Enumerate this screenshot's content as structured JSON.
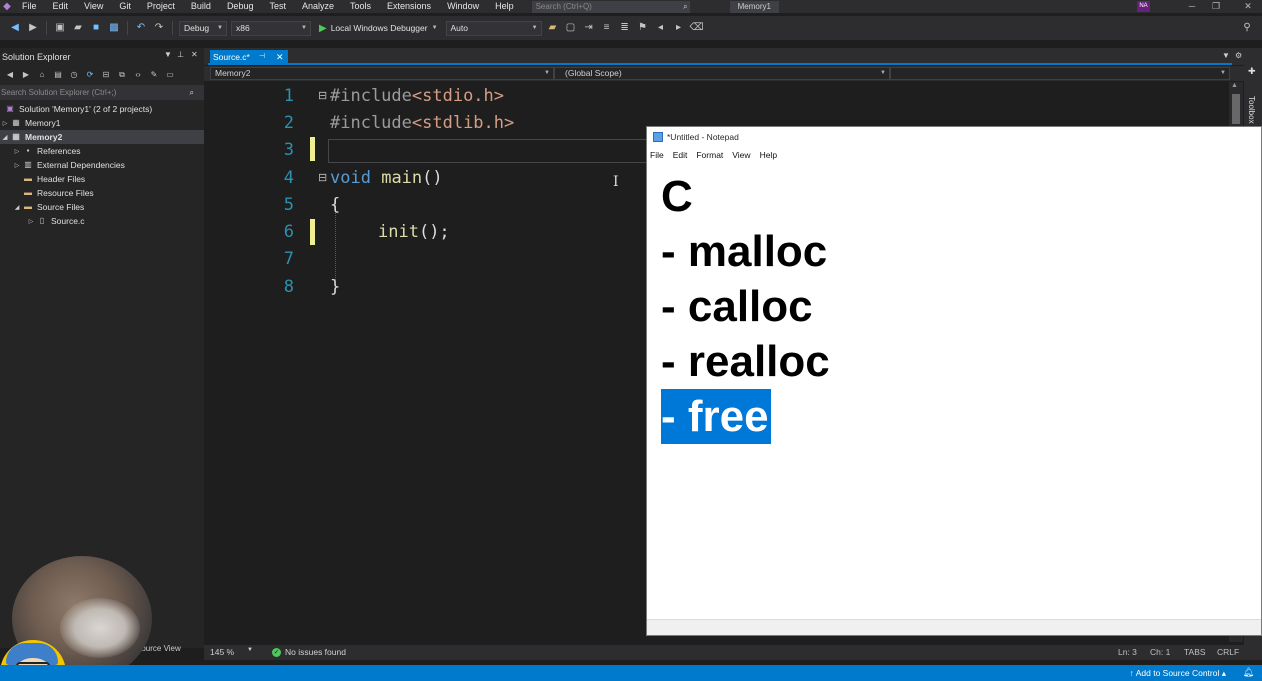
{
  "menubar": {
    "items": [
      "File",
      "Edit",
      "View",
      "Git",
      "Project",
      "Build",
      "Debug",
      "Test",
      "Analyze",
      "Tools",
      "Extensions",
      "Window",
      "Help"
    ],
    "search_placeholder": "Search (Ctrl+Q)",
    "solution_name": "Memory1",
    "avatar_initials": "NA"
  },
  "toolbar": {
    "config": "Debug",
    "platform": "x86",
    "run_label": "Local Windows Debugger",
    "auto": "Auto"
  },
  "solution_explorer": {
    "title": "Solution Explorer",
    "search_placeholder": "Search Solution Explorer (Ctrl+;)",
    "tree": [
      {
        "label": "Solution 'Memory1' (2 of 2 projects)",
        "level": 0,
        "expander": "",
        "icon": "solution-icon",
        "selected": false
      },
      {
        "label": "Memory1",
        "level": 1,
        "expander": "▷",
        "icon": "project-icon",
        "selected": false
      },
      {
        "label": "Memory2",
        "level": 1,
        "expander": "◢",
        "icon": "project-icon",
        "selected": true
      },
      {
        "label": "References",
        "level": 2,
        "expander": "▷",
        "icon": "references-icon",
        "selected": false
      },
      {
        "label": "External Dependencies",
        "level": 2,
        "expander": "▷",
        "icon": "external-deps-icon",
        "selected": false
      },
      {
        "label": "Header Files",
        "level": 2,
        "expander": "",
        "icon": "folder-icon",
        "selected": false
      },
      {
        "label": "Resource Files",
        "level": 2,
        "expander": "",
        "icon": "folder-icon",
        "selected": false
      },
      {
        "label": "Source Files",
        "level": 2,
        "expander": "◢",
        "icon": "folder-icon",
        "selected": false
      },
      {
        "label": "Source.c",
        "level": 3,
        "expander": "▷",
        "icon": "c-file-icon",
        "selected": false
      }
    ],
    "bottom_tab": "Source View"
  },
  "editor": {
    "tab_label": "Source.c*",
    "project_combo": "Memory2",
    "scope_combo": "(Global Scope)",
    "line_numbers": [
      "1",
      "2",
      "3",
      "4",
      "5",
      "6",
      "7",
      "8"
    ],
    "code": {
      "l1_pp": "#include",
      "l1_inc": "<stdio.h>",
      "l2_pp": "#include",
      "l2_inc": "<stdlib.h>",
      "l4_kw": "void",
      "l4_fn": "main",
      "l4_rest": "()",
      "l5": "{",
      "l6_fn": "init",
      "l6_rest": "();",
      "l8": "}"
    },
    "zoom": "145 %",
    "issues": "No issues found",
    "position": {
      "ln": "Ln: 3",
      "ch": "Ch: 1",
      "tabs": "TABS",
      "eol": "CRLF"
    }
  },
  "toolbox_label": "Toolbox",
  "statusbar": {
    "source_control": "Add to Source Control"
  },
  "notepad": {
    "title": "*Untitled - Notepad",
    "menu": [
      "File",
      "Edit",
      "Format",
      "View",
      "Help"
    ],
    "lines": [
      "C",
      "- malloc",
      "- calloc",
      "- realloc",
      "- free"
    ],
    "selected_line_index": 4
  },
  "colors": {
    "accent": "#007acc",
    "selection": "#0078d7",
    "change_bar": "#efef91"
  }
}
